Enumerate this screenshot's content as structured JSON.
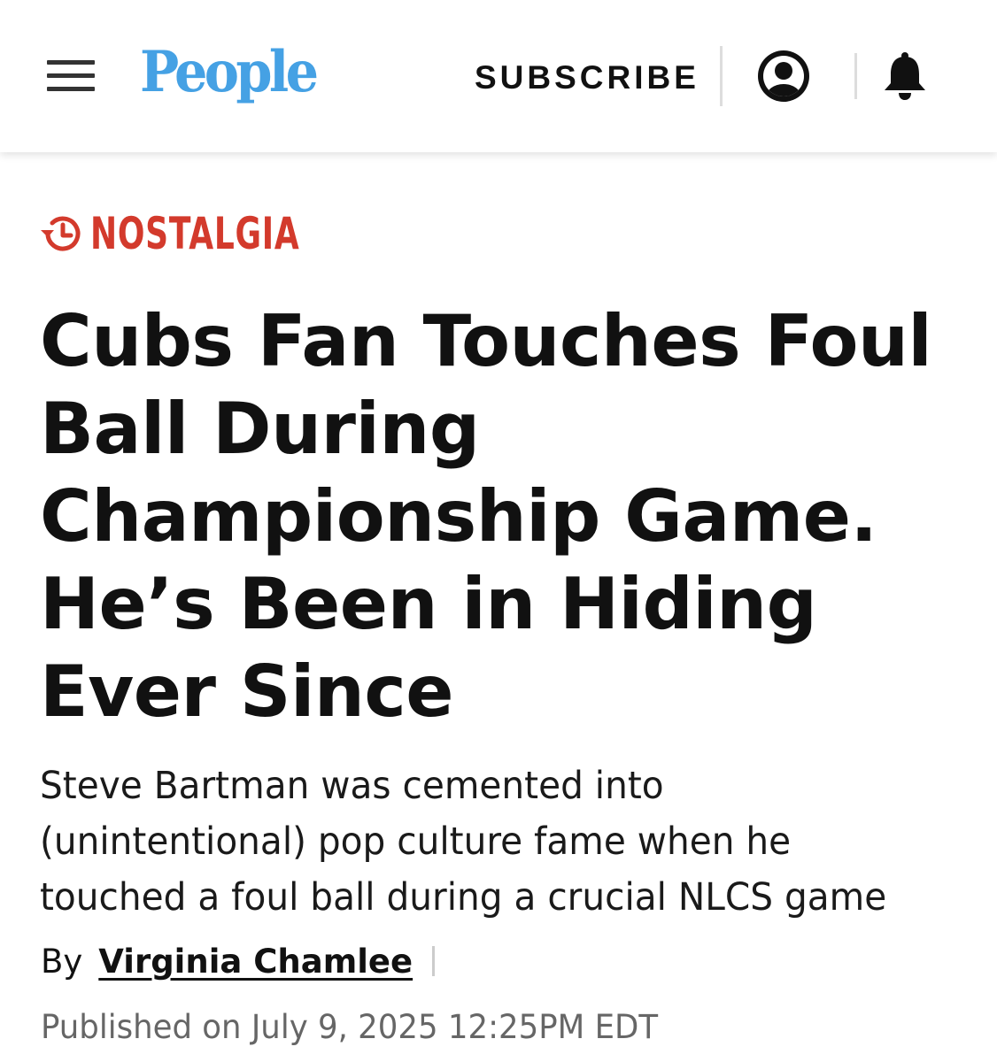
{
  "header": {
    "logo": "People",
    "subscribe_label": "SUBSCRIBE",
    "logo_color": "#45a1e4"
  },
  "icons": {
    "menu": "hamburger-menu-icon",
    "account": "account-icon",
    "notifications": "bell-icon",
    "category": "history-clock-icon"
  },
  "article": {
    "category": "NOSTALGIA",
    "category_color": "#d33a2c",
    "headline": "Cubs Fan Touches Foul Ball During Championship Game. He’s Been in Hiding Ever Since",
    "dek": "Steve Bartman was cemented into (unintentional) pop culture fame when he touched a foul ball during a crucial NLCS game",
    "byline_prefix": "By",
    "author": "Virginia Chamlee",
    "published": "Published on July 9, 2025 12:25PM EDT"
  }
}
